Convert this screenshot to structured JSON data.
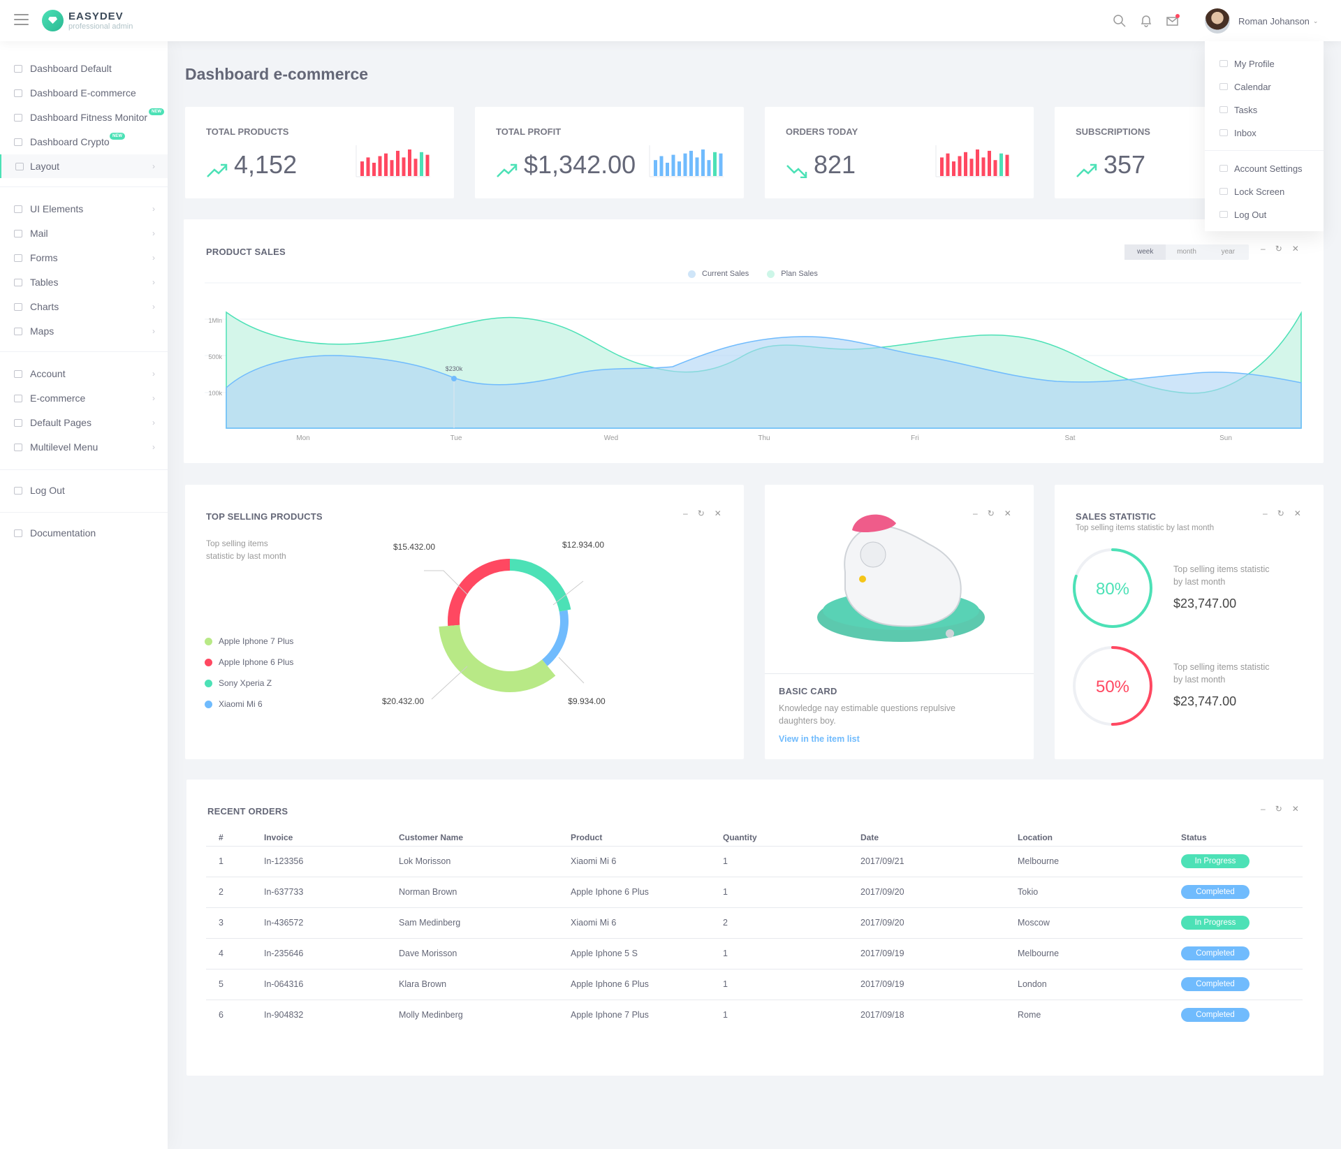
{
  "app": {
    "brand": "EASYDEV",
    "brand_sub": "professional admin"
  },
  "topbar": {
    "user_name": "Roman Johanson",
    "icons": [
      "search-icon",
      "bell-icon",
      "mail-icon"
    ]
  },
  "user_menu": {
    "items": [
      "My Profile",
      "Calendar",
      "Tasks",
      "Inbox"
    ],
    "items2": [
      "Account Settings",
      "Lock Screen",
      "Log Out"
    ]
  },
  "sidebar": {
    "group1": [
      {
        "label": "Dashboard Default",
        "icon": "home-icon"
      },
      {
        "label": "Dashboard E-commerce",
        "icon": "store-icon"
      },
      {
        "label": "Dashboard Fitness Monitor",
        "icon": "heart-icon",
        "badge": "NEW"
      },
      {
        "label": "Dashboard Crypto",
        "icon": "rocket-icon",
        "badge": "NEW"
      },
      {
        "label": "Layout",
        "icon": "layers-icon"
      }
    ],
    "group2": [
      {
        "label": "UI Elements",
        "icon": "diamond-icon"
      },
      {
        "label": "Mail",
        "icon": "envelope-icon"
      },
      {
        "label": "Forms",
        "icon": "file-icon"
      },
      {
        "label": "Tables",
        "icon": "list-icon"
      },
      {
        "label": "Charts",
        "icon": "chart-icon"
      },
      {
        "label": "Maps",
        "icon": "map-icon"
      }
    ],
    "group3": [
      {
        "label": "Account",
        "icon": "user-icon"
      },
      {
        "label": "E-commerce",
        "icon": "cart-icon"
      },
      {
        "label": "Default Pages",
        "icon": "page-icon"
      },
      {
        "label": "Multilevel Menu",
        "icon": "menu-icon"
      }
    ],
    "logout": "Log Out",
    "documentation": "Documentation"
  },
  "page_title": "Dashboard e-commerce",
  "kpis": [
    {
      "title": "Total Products",
      "value": "4,152",
      "trend": "up",
      "bars": [
        0.55,
        0.7,
        0.5,
        0.75,
        0.85,
        0.6,
        0.95,
        0.7,
        1.0,
        0.65,
        0.9,
        0.8
      ],
      "color": "#ff4861"
    },
    {
      "title": "Total Profit",
      "value": "$1,342.00",
      "trend": "up",
      "bars": [
        0.6,
        0.75,
        0.5,
        0.8,
        0.55,
        0.85,
        0.95,
        0.7,
        1.0,
        0.6,
        0.9,
        0.85
      ],
      "color": "#70bbfd"
    },
    {
      "title": "Orders Today",
      "value": "821",
      "trend": "down",
      "bars": [
        0.7,
        0.85,
        0.55,
        0.75,
        0.9,
        0.65,
        1.0,
        0.7,
        0.95,
        0.6,
        0.85,
        0.8
      ],
      "color": "#ff4861"
    },
    {
      "title": "Subscriptions",
      "value": "357",
      "trend": "up"
    }
  ],
  "product_sales": {
    "title": "Product Sales",
    "ranges": [
      "week",
      "month",
      "year"
    ],
    "active_range": "week",
    "legend": [
      "Current Sales",
      "Plan Sales"
    ],
    "tooltip": "$230k",
    "chart_data": {
      "type": "area",
      "categories": [
        "Mon",
        "Tue",
        "Wed",
        "Thu",
        "Fri",
        "Sat",
        "Sun"
      ],
      "y_ticks": [
        "100k",
        "500k",
        "1Mln"
      ],
      "series": [
        {
          "name": "Current Sales",
          "color": "#70bbfd"
        },
        {
          "name": "Plan Sales",
          "color": "#4ce1b6"
        }
      ]
    }
  },
  "top_selling": {
    "title": "Top Selling Products",
    "subtitle": "Top selling items statistic by last month",
    "legend": [
      {
        "name": "Apple Iphone 7 Plus",
        "color": "#b8e986"
      },
      {
        "name": "Apple Iphone 6 Plus",
        "color": "#ff4861"
      },
      {
        "name": "Sony Xperia Z",
        "color": "#4ce1b6"
      },
      {
        "name": "Xiaomi Mi 6",
        "color": "#70bbfd"
      }
    ],
    "chart_data": {
      "type": "pie",
      "slices": [
        {
          "name": "Sony Xperia Z",
          "value": 12934.0,
          "label": "$12.934.00"
        },
        {
          "name": "Xiaomi Mi 6",
          "value": 9934.0,
          "label": "$9.934.00"
        },
        {
          "name": "Apple Iphone 7 Plus",
          "value": 20432.0,
          "label": "$20.432.00"
        },
        {
          "name": "Apple Iphone 6 Plus",
          "value": 15432.0,
          "label": "$15.432.00"
        }
      ]
    }
  },
  "basic_card": {
    "title": "Basic Card",
    "text": "Knowledge nay estimable questions repulsive daughters boy.",
    "link": "View in the item list"
  },
  "sales_statistic": {
    "title": "Sales Statistic",
    "subtitle": "Top selling items statistic by last month",
    "items": [
      {
        "percent": "80%",
        "fraction": 0.8,
        "color": "#4ce1b6",
        "text": "Top selling items statistic by last month",
        "value": "$23,747.00"
      },
      {
        "percent": "50%",
        "fraction": 0.5,
        "color": "#ff4861",
        "text": "Top selling items statistic by last month",
        "value": "$23,747.00"
      }
    ]
  },
  "recent_orders": {
    "title": "Recent Orders",
    "columns": [
      "#",
      "Invoice",
      "Customer Name",
      "Product",
      "Quantity",
      "Date",
      "Location",
      "Status"
    ],
    "rows": [
      [
        "1",
        "In-123356",
        "Lok Morisson",
        "Xiaomi Mi 6",
        "1",
        "2017/09/21",
        "Melbourne",
        "In Progress"
      ],
      [
        "2",
        "In-637733",
        "Norman Brown",
        "Apple Iphone 6 Plus",
        "1",
        "2017/09/20",
        "Tokio",
        "Completed"
      ],
      [
        "3",
        "In-436572",
        "Sam Medinberg",
        "Xiaomi Mi 6",
        "2",
        "2017/09/20",
        "Moscow",
        "In Progress"
      ],
      [
        "4",
        "In-235646",
        "Dave Morisson",
        "Apple Iphone 5 S",
        "1",
        "2017/09/19",
        "Melbourne",
        "Completed"
      ],
      [
        "5",
        "In-064316",
        "Klara Brown",
        "Apple Iphone 6 Plus",
        "1",
        "2017/09/19",
        "London",
        "Completed"
      ],
      [
        "6",
        "In-904832",
        "Molly Medinberg",
        "Apple Iphone 7 Plus",
        "1",
        "2017/09/18",
        "Rome",
        "Completed"
      ]
    ],
    "status_colors": {
      "In Progress": "#4ce1b6",
      "Completed": "#70bbfd"
    }
  },
  "colors": {
    "accent": "#4ce1b6",
    "blue": "#70bbfd",
    "red": "#ff4861",
    "lime": "#b8e986"
  }
}
